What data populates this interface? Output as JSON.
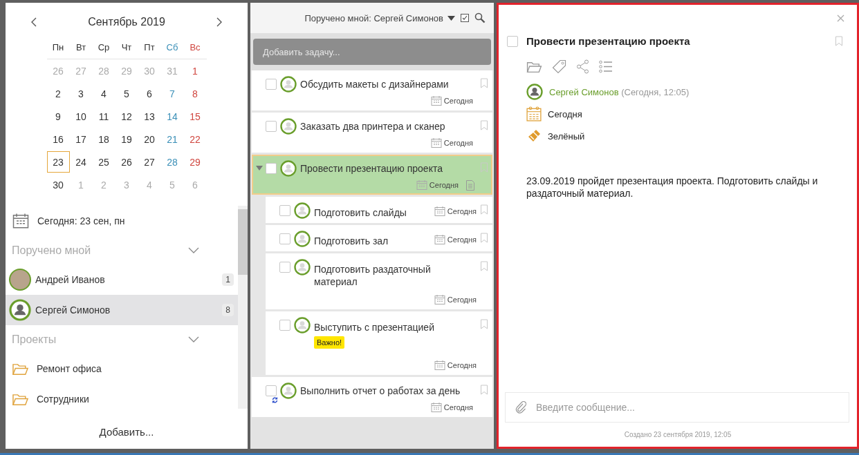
{
  "calendar": {
    "month_title": "Сентябрь 2019",
    "weekdays": [
      {
        "text": "Пн",
        "kind": "work"
      },
      {
        "text": "Вт",
        "kind": "work"
      },
      {
        "text": "Ср",
        "kind": "work"
      },
      {
        "text": "Чт",
        "kind": "work"
      },
      {
        "text": "Пт",
        "kind": "work"
      },
      {
        "text": "Сб",
        "kind": "sat"
      },
      {
        "text": "Вс",
        "kind": "sun"
      }
    ],
    "weeks": [
      [
        {
          "text": "26",
          "kind": "muted",
          "selected": false
        },
        {
          "text": "27",
          "kind": "muted",
          "selected": false
        },
        {
          "text": "28",
          "kind": "muted",
          "selected": false
        },
        {
          "text": "29",
          "kind": "muted",
          "selected": false
        },
        {
          "text": "30",
          "kind": "muted",
          "selected": false
        },
        {
          "text": "31",
          "kind": "muted",
          "selected": false
        },
        {
          "text": "1",
          "kind": "sun",
          "selected": false
        }
      ],
      [
        {
          "text": "2",
          "kind": "work",
          "selected": false
        },
        {
          "text": "3",
          "kind": "work",
          "selected": false
        },
        {
          "text": "4",
          "kind": "work",
          "selected": false
        },
        {
          "text": "5",
          "kind": "work",
          "selected": false
        },
        {
          "text": "6",
          "kind": "work",
          "selected": false
        },
        {
          "text": "7",
          "kind": "sat",
          "selected": false
        },
        {
          "text": "8",
          "kind": "sun",
          "selected": false
        }
      ],
      [
        {
          "text": "9",
          "kind": "work",
          "selected": false
        },
        {
          "text": "10",
          "kind": "work",
          "selected": false
        },
        {
          "text": "11",
          "kind": "work",
          "selected": false
        },
        {
          "text": "12",
          "kind": "work",
          "selected": false
        },
        {
          "text": "13",
          "kind": "work",
          "selected": false
        },
        {
          "text": "14",
          "kind": "sat",
          "selected": false
        },
        {
          "text": "15",
          "kind": "sun",
          "selected": false
        }
      ],
      [
        {
          "text": "16",
          "kind": "work",
          "selected": false
        },
        {
          "text": "17",
          "kind": "work",
          "selected": false
        },
        {
          "text": "18",
          "kind": "work",
          "selected": false
        },
        {
          "text": "19",
          "kind": "work",
          "selected": false
        },
        {
          "text": "20",
          "kind": "work",
          "selected": false
        },
        {
          "text": "21",
          "kind": "sat",
          "selected": false
        },
        {
          "text": "22",
          "kind": "sun",
          "selected": false
        }
      ],
      [
        {
          "text": "23",
          "kind": "work",
          "selected": true
        },
        {
          "text": "24",
          "kind": "work",
          "selected": false
        },
        {
          "text": "25",
          "kind": "work",
          "selected": false
        },
        {
          "text": "26",
          "kind": "work",
          "selected": false
        },
        {
          "text": "27",
          "kind": "work",
          "selected": false
        },
        {
          "text": "28",
          "kind": "sat",
          "selected": false
        },
        {
          "text": "29",
          "kind": "sun",
          "selected": false
        }
      ],
      [
        {
          "text": "30",
          "kind": "work",
          "selected": false
        },
        {
          "text": "1",
          "kind": "muted",
          "selected": false
        },
        {
          "text": "2",
          "kind": "muted",
          "selected": false
        },
        {
          "text": "3",
          "kind": "muted",
          "selected": false
        },
        {
          "text": "4",
          "kind": "muted",
          "selected": false
        },
        {
          "text": "5",
          "kind": "muted",
          "selected": false
        },
        {
          "text": "6",
          "kind": "muted",
          "selected": false
        }
      ]
    ]
  },
  "sidebar": {
    "today": "Сегодня: 23 сен, пн",
    "sections": [
      {
        "title": "Поручено мной",
        "expanded": true,
        "items": [
          {
            "kind": "person",
            "photo": true,
            "name": "Андрей Иванов",
            "count": "1",
            "selected": false
          },
          {
            "kind": "person",
            "photo": false,
            "name": "Сергей Симонов",
            "count": "8",
            "selected": true
          }
        ]
      },
      {
        "title": "Проекты",
        "expanded": true,
        "items": [
          {
            "kind": "project",
            "name": "Ремонт офиса",
            "selected": false
          },
          {
            "kind": "project",
            "name": "Сотрудники",
            "selected": false
          }
        ]
      }
    ],
    "add_button": "Добавить..."
  },
  "tasks_panel": {
    "filter": "Поручено мной: Сергей Симонов",
    "add_placeholder": "Добавить задачу...",
    "tasks": [
      {
        "title": "Обсудить макеты с дизайнерами",
        "date": "Сегодня",
        "checked": false,
        "selected": false,
        "expanded": false,
        "recurring": false,
        "has_note": false
      },
      {
        "title": "Заказать два принтера и сканер",
        "date": "Сегодня",
        "checked": false,
        "selected": false,
        "expanded": false,
        "recurring": false,
        "has_note": false
      },
      {
        "title": "Провести презентацию проекта",
        "date": "Сегодня",
        "checked": false,
        "selected": true,
        "expanded": true,
        "recurring": false,
        "has_note": true,
        "children": [
          {
            "title": "Подготовить слайды",
            "date": "Сегодня",
            "checked": false,
            "selected": false
          },
          {
            "title": "Подготовить зал",
            "date": "Сегодня",
            "checked": false,
            "selected": false
          },
          {
            "title": "Подготовить раздаточный материал",
            "date": "Сегодня",
            "checked": false,
            "selected": false
          },
          {
            "title": "Выступить с презентацией",
            "tag": "Важно!",
            "date": "Сегодня",
            "checked": false,
            "selected": false
          }
        ]
      },
      {
        "title": "Выполнить отчет о работах за день",
        "date": "Сегодня",
        "checked": false,
        "selected": false,
        "expanded": false,
        "recurring": true,
        "has_note": false
      }
    ]
  },
  "detail": {
    "title": "Провести презентацию проекта",
    "checked": false,
    "assignee": {
      "name": "Сергей Симонов",
      "time": "(Сегодня, 12:05)"
    },
    "due": "Сегодня",
    "color_label": "Зелёный",
    "description": "23.09.2019 пройдет презентация проекта. Подготовить слайды и раздаточный материал.",
    "message_placeholder": "Введите сообщение...",
    "created": "Создано 23 сентября 2019, 12:05"
  }
}
